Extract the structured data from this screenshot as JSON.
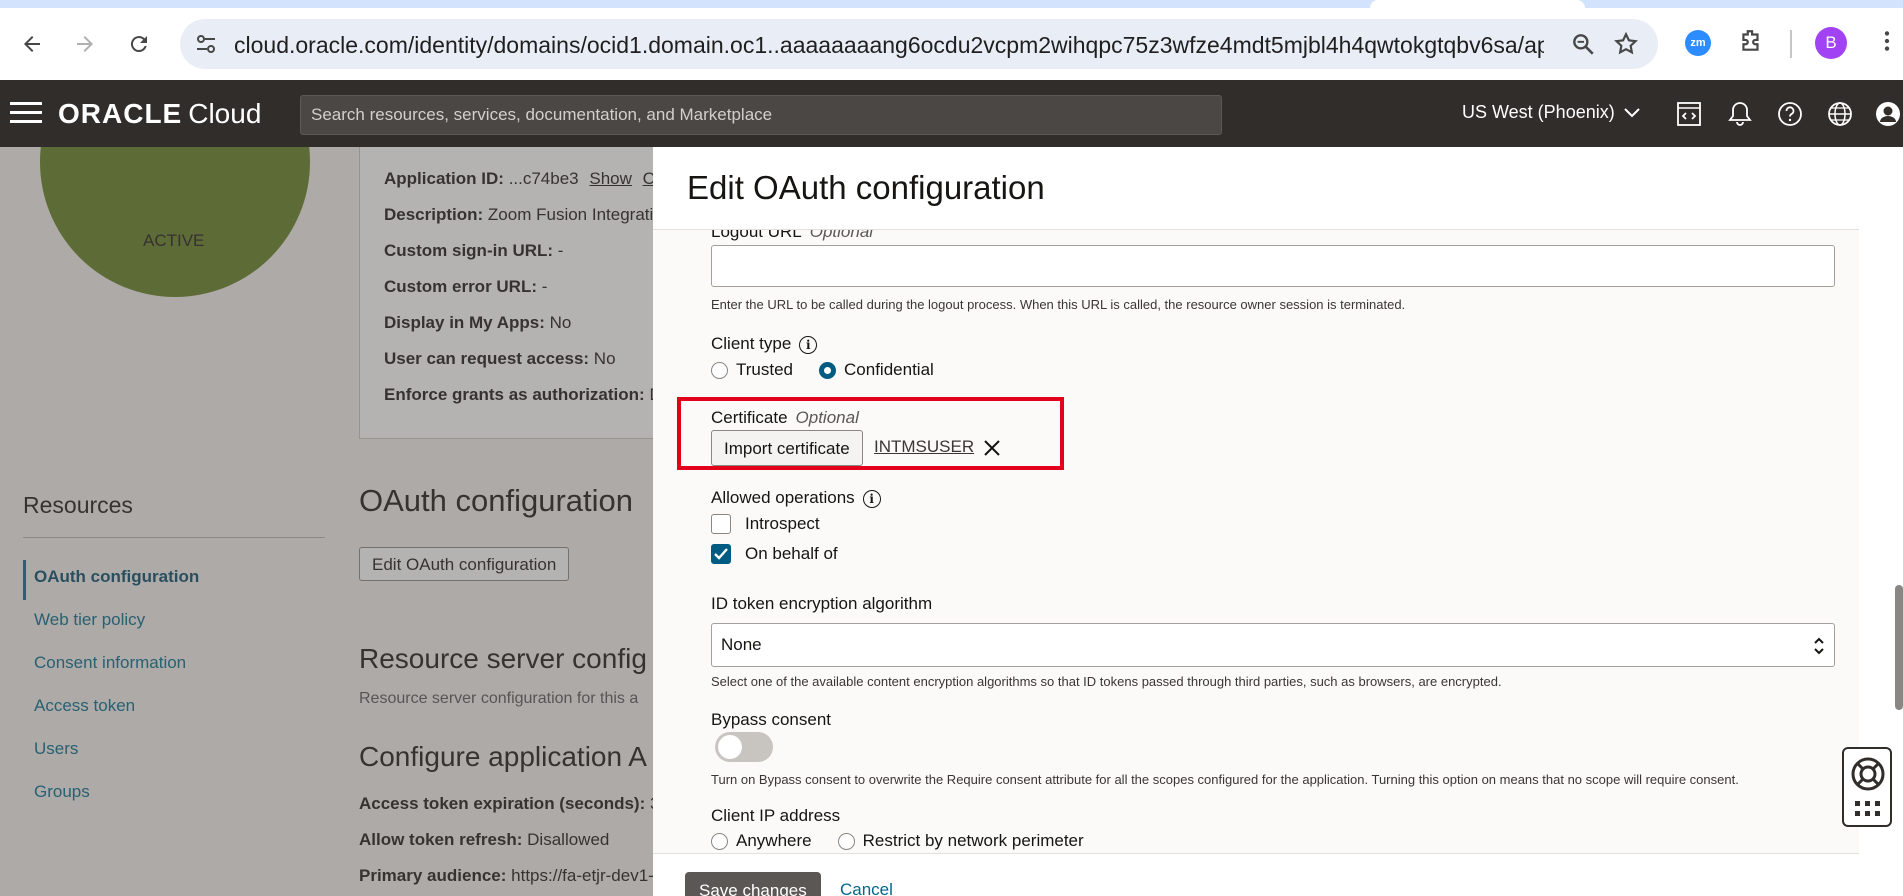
{
  "browser": {
    "url": "cloud.oracle.com/identity/domains/ocid1.domain.oc1..aaaaaaaang6ocdu2vcpm2wihqpc75z3wfze4mdt5mjbl4h4qwtokgtqbv6sa/applications/...",
    "profile_initial": "B",
    "zoom_ext_label": "zm"
  },
  "header": {
    "brand_oracle": "ORACLE",
    "brand_cloud": "Cloud",
    "search_placeholder": "Search resources, services, documentation, and Marketplace",
    "region": "US West (Phoenix)"
  },
  "background": {
    "status": "ACTIVE",
    "details": [
      {
        "label": "Application ID:",
        "value": "...c74be3",
        "link": "Show",
        "link2": "C"
      },
      {
        "label": "Description:",
        "value": "Zoom Fusion Integratio"
      },
      {
        "label": "Custom sign-in URL:",
        "value": "-"
      },
      {
        "label": "Custom error URL:",
        "value": "-"
      },
      {
        "label": "Display in My Apps:",
        "value": "No"
      },
      {
        "label": "User can request access:",
        "value": "No"
      },
      {
        "label": "Enforce grants as authorization:",
        "value": "D"
      }
    ],
    "resources_heading": "Resources",
    "resources": [
      "OAuth configuration",
      "Web tier policy",
      "Consent information",
      "Access token",
      "Users",
      "Groups"
    ],
    "oauth_heading": "OAuth configuration",
    "edit_button": "Edit OAuth configuration",
    "resource_server_heading": "Resource server config",
    "resource_server_desc": "Resource server configuration for this a",
    "configure_heading": "Configure application A",
    "token_lines": [
      {
        "label": "Access token expiration (seconds):",
        "value": "3"
      },
      {
        "label": "Allow token refresh:",
        "value": "Disallowed"
      },
      {
        "label": "Primary audience:",
        "value": "https://fa-etjr-dev1-s"
      }
    ]
  },
  "drawer": {
    "title": "Edit OAuth configuration",
    "logout_label": "Logout URL",
    "optional": "Optional",
    "logout_value": "",
    "logout_help": "Enter the URL to be called during the logout process. When this URL is called, the resource owner session is terminated.",
    "client_type_label": "Client type",
    "client_type_options": [
      "Trusted",
      "Confidential"
    ],
    "client_type_selected": "Confidential",
    "certificate_label": "Certificate",
    "import_certificate": "Import certificate",
    "certificate_name": "INTMSUSER",
    "allowed_ops_label": "Allowed operations",
    "allowed_ops": [
      {
        "label": "Introspect",
        "checked": false
      },
      {
        "label": "On behalf of",
        "checked": true
      }
    ],
    "id_token_label": "ID token encryption algorithm",
    "id_token_value": "None",
    "id_token_help": "Select one of the available content encryption algorithms so that ID tokens passed through third parties, such as browsers, are encrypted.",
    "bypass_label": "Bypass consent",
    "bypass_on": false,
    "bypass_help": "Turn on Bypass consent to overwrite the Require consent attribute for all the scopes configured for the application. Turning this option on means that no scope will require consent.",
    "client_ip_label": "Client IP address",
    "client_ip_options": [
      "Anywhere",
      "Restrict by network perimeter"
    ],
    "save_button": "Save changes",
    "cancel_link": "Cancel"
  },
  "colors": {
    "header_bg": "#312d2a",
    "accent": "#005b82",
    "link": "#00688c",
    "highlight": "#e2001a"
  }
}
